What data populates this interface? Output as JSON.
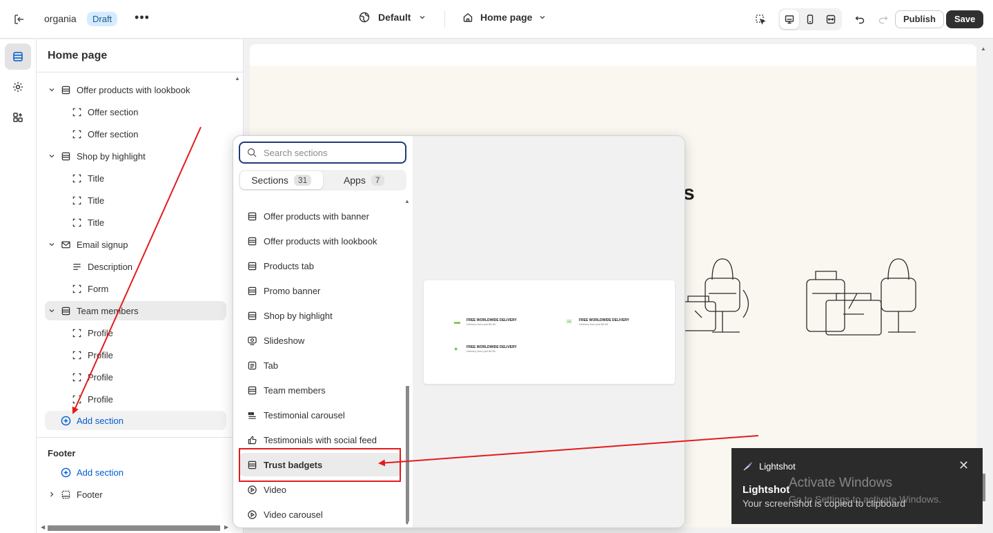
{
  "topbar": {
    "store_name": "organia",
    "status_badge": "Draft",
    "more_label": "•••",
    "theme_label": "Default",
    "page_label": "Home page",
    "publish_label": "Publish",
    "save_label": "Save"
  },
  "sidebar": {
    "title": "Home page",
    "tree": [
      {
        "label": "Offer products with lookbook",
        "level": 0,
        "icon": "section-icon"
      },
      {
        "label": "Offer section",
        "level": 1,
        "icon": "block-icon"
      },
      {
        "label": "Offer section",
        "level": 1,
        "icon": "block-icon"
      },
      {
        "label": "Shop by highlight",
        "level": 0,
        "icon": "section-icon"
      },
      {
        "label": "Title",
        "level": 1,
        "icon": "block-icon"
      },
      {
        "label": "Title",
        "level": 1,
        "icon": "block-icon"
      },
      {
        "label": "Title",
        "level": 1,
        "icon": "block-icon"
      },
      {
        "label": "Email signup",
        "level": 0,
        "icon": "mail-icon"
      },
      {
        "label": "Description",
        "level": 1,
        "icon": "text-icon"
      },
      {
        "label": "Form",
        "level": 1,
        "icon": "block-icon"
      },
      {
        "label": "Team members",
        "level": 0,
        "icon": "section-icon"
      },
      {
        "label": "Profile",
        "level": 1,
        "icon": "block-icon"
      },
      {
        "label": "Profile",
        "level": 1,
        "icon": "block-icon"
      },
      {
        "label": "Profile",
        "level": 1,
        "icon": "block-icon"
      },
      {
        "label": "Profile",
        "level": 1,
        "icon": "block-icon"
      }
    ],
    "add_section_label": "Add section",
    "footer_group_title": "Footer",
    "footer_add_section_label": "Add section",
    "footer_item_label": "Footer"
  },
  "popup": {
    "search_placeholder": "Search sections",
    "tabs": [
      {
        "label": "Sections",
        "count": "31"
      },
      {
        "label": "Apps",
        "count": "7"
      }
    ],
    "items": [
      {
        "label": "Offer products with banner",
        "icon": "section-icon"
      },
      {
        "label": "Offer products with lookbook",
        "icon": "section-icon"
      },
      {
        "label": "Products tab",
        "icon": "section-icon"
      },
      {
        "label": "Promo banner",
        "icon": "section-icon"
      },
      {
        "label": "Shop by highlight",
        "icon": "section-icon"
      },
      {
        "label": "Slideshow",
        "icon": "slideshow-icon"
      },
      {
        "label": "Tab",
        "icon": "tab-icon"
      },
      {
        "label": "Team members",
        "icon": "section-icon"
      },
      {
        "label": "Testimonial carousel",
        "icon": "quote-icon"
      },
      {
        "label": "Testimonials with social feed",
        "icon": "thumbs-up-icon"
      },
      {
        "label": "Trust badgets",
        "icon": "section-icon"
      },
      {
        "label": "Video",
        "icon": "play-icon"
      },
      {
        "label": "Video carousel",
        "icon": "play-icon"
      }
    ],
    "selected_index": 10,
    "preview_badges": [
      {
        "title": "FREE WORLDWIDE DELIVERY",
        "subtitle": "Delivery from just $9.60"
      },
      {
        "title": "FREE WORLDWIDE DELIVERY",
        "subtitle": "Delivery from just $9.60"
      },
      {
        "title": "FREE WORLDWIDE DELIVERY",
        "subtitle": "Delivery from just $9.60"
      }
    ]
  },
  "preview": {
    "heading_fragment": "s"
  },
  "toast": {
    "app_name": "Lightshot",
    "title": "Lightshot",
    "message": "Your screenshot is copied to clipboard"
  },
  "watermark": {
    "line1": "Activate Windows",
    "line2": "Go to Settings to activate Windows."
  },
  "colors": {
    "accent": "#005bd3",
    "annotation": "#e31b1b",
    "save_bg": "#303030",
    "draft_bg": "#d5ebff"
  }
}
